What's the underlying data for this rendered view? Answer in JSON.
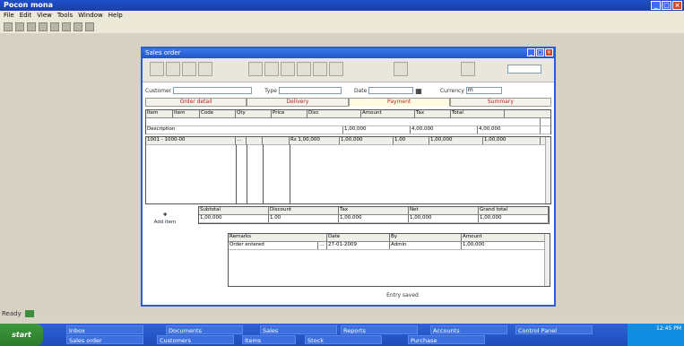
{
  "app": {
    "title": "Pocon mona",
    "menu": [
      "File",
      "Edit",
      "View",
      "Tools",
      "Window",
      "Help"
    ]
  },
  "dialog": {
    "title": "Sales order",
    "top_select": "",
    "row1": {
      "label_a": "Customer",
      "value_a": "",
      "label_b": "Type",
      "value_b": "",
      "label_c": "Date",
      "value_c": "",
      "label_d": "Currency",
      "value_d": "m"
    },
    "tabs": [
      "Order detail",
      "Delivery",
      "Payment",
      "Summary"
    ],
    "header_grid": {
      "columns": [
        "Item",
        "Item",
        "Code",
        "Qty",
        "Price",
        "Disc",
        "Amount",
        "Tax",
        "Total"
      ],
      "row_left": "Description",
      "row_vals": [
        "1,00,000",
        "4,00,000",
        "4,00,000"
      ]
    },
    "lines_grid": {
      "row": [
        "1001 - 1000-00",
        "",
        "",
        "Rs 1,00,000",
        "1,00,000",
        "1.00",
        "1,00,000",
        "1,00,000"
      ]
    },
    "add_button": "Add item",
    "summary": {
      "labels": [
        "Subtotal",
        "Discount",
        "Tax",
        "Net",
        "Grand total"
      ],
      "values": [
        "1,00,000",
        "1.00",
        "1,00,000",
        "1,00,000",
        "1,00,000"
      ]
    },
    "remarks_grid": {
      "columns": [
        "Remarks",
        "Date",
        "By",
        "Amount"
      ],
      "row": [
        "Order entered",
        "27-01-2009",
        "Admin",
        "1,00,000"
      ]
    },
    "footer_note": "Entry saved"
  },
  "status": {
    "text": "Ready"
  },
  "taskbar": {
    "start": "start",
    "items_top": [
      "Inbox",
      "Documents",
      "Sales",
      "Reports",
      "Accounts",
      "Control Panel"
    ],
    "items_bottom": [
      "Sales order",
      "Customers",
      "Items",
      "Stock",
      "Purchase"
    ],
    "clock": "12:45 PM"
  }
}
